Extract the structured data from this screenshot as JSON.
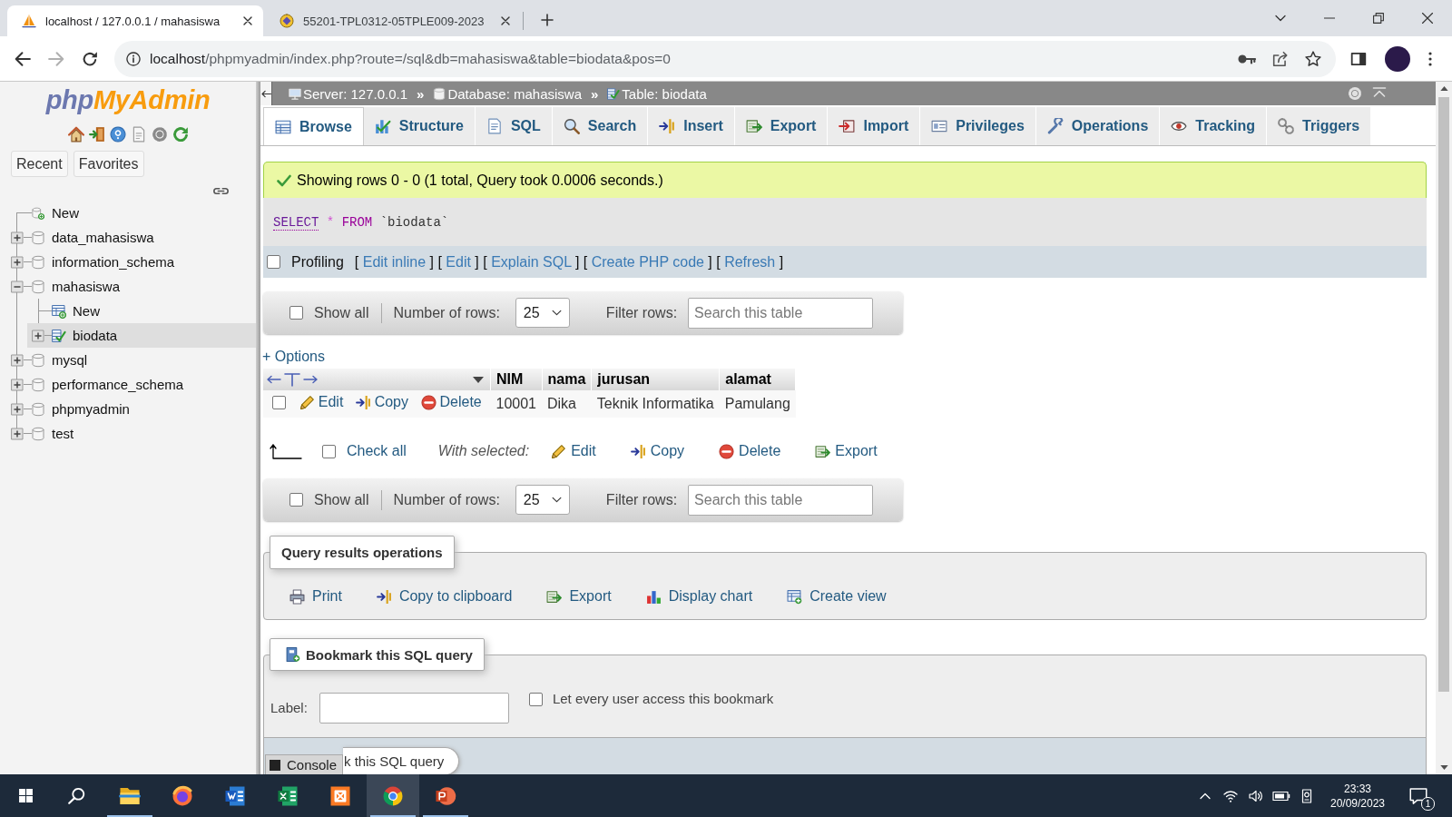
{
  "browser": {
    "tabs": [
      {
        "title": "localhost / 127.0.0.1 / mahasiswa",
        "selected": true
      },
      {
        "title": "55201-TPL0312-05TPLE009-2023",
        "selected": false
      }
    ],
    "can_go_forward": false,
    "url_host": "localhost",
    "url_path": "/phpmyadmin/index.php?route=/sql&db=mahasiswa&table=biodata&pos=0"
  },
  "sidebar": {
    "logo": {
      "prefix": "php",
      "name": "MyAdmin"
    },
    "buttons": [
      "Recent",
      "Favorites"
    ],
    "tree": [
      {
        "label": "New",
        "kind": "new_database",
        "selected": false
      },
      {
        "label": "data_mahasiswa",
        "kind": "database",
        "expanded": false,
        "selected": false
      },
      {
        "label": "information_schema",
        "kind": "database",
        "expanded": false,
        "selected": false
      },
      {
        "label": "mahasiswa",
        "kind": "database",
        "expanded": true,
        "selected": false,
        "children": [
          {
            "label": "New",
            "kind": "new_table",
            "selected": false
          },
          {
            "label": "biodata",
            "kind": "table",
            "expanded": false,
            "selected": true
          }
        ]
      },
      {
        "label": "mysql",
        "kind": "database",
        "expanded": false,
        "selected": false
      },
      {
        "label": "performance_schema",
        "kind": "database",
        "expanded": false,
        "selected": false
      },
      {
        "label": "phpmyadmin",
        "kind": "database",
        "expanded": false,
        "selected": false
      },
      {
        "label": "test",
        "kind": "database",
        "expanded": false,
        "selected": false
      }
    ]
  },
  "breadcrumb": [
    {
      "label": "Server: 127.0.0.1",
      "separator": "»"
    },
    {
      "label": "Database: mahasiswa",
      "separator": "»"
    },
    {
      "label": "Table: biodata"
    }
  ],
  "tabs": [
    {
      "label": "Browse",
      "selected": true
    },
    {
      "label": "Structure",
      "selected": false
    },
    {
      "label": "SQL",
      "selected": false
    },
    {
      "label": "Search",
      "selected": false
    },
    {
      "label": "Insert",
      "selected": false
    },
    {
      "label": "Export",
      "selected": false
    },
    {
      "label": "Import",
      "selected": false
    },
    {
      "label": "Privileges",
      "selected": false
    },
    {
      "label": "Operations",
      "selected": false
    },
    {
      "label": "Tracking",
      "selected": false
    },
    {
      "label": "Triggers",
      "selected": false
    }
  ],
  "message": {
    "kind": "success",
    "text": "Showing rows 0 - 0 (1 total, Query took 0.0006 seconds.)"
  },
  "sql": [
    {
      "text": "SELECT",
      "kind": "keyword",
      "link": true
    },
    {
      "text": "*",
      "kind": "operator",
      "link": false
    },
    {
      "text": "FROM",
      "kind": "keyword",
      "link": false
    },
    {
      "text": "`biodata`",
      "kind": "identifier",
      "link": false
    }
  ],
  "profiling": {
    "label": "Profiling",
    "checked": false,
    "links": [
      {
        "open": "[",
        "label": "Edit inline",
        "close": "]"
      },
      {
        "open": "[",
        "label": "Edit",
        "close": "]"
      },
      {
        "open": "[",
        "label": "Explain SQL",
        "close": "]"
      },
      {
        "open": "[",
        "label": "Create PHP code",
        "close": "]"
      },
      {
        "open": "[",
        "label": "Refresh",
        "close": "]"
      }
    ]
  },
  "navigation_bars": [
    {
      "show_all": {
        "label": "Show all",
        "checked": false
      },
      "rows_label": "Number of rows:",
      "rows_value": "25",
      "filter_label": "Filter rows:",
      "filter_placeholder": "Search this table"
    },
    {
      "show_all": {
        "label": "Show all",
        "checked": false
      },
      "rows_label": "Number of rows:",
      "rows_value": "25",
      "filter_label": "Filter rows:",
      "filter_placeholder": "Search this table"
    }
  ],
  "options_link": "+ Options",
  "table": {
    "columns": [
      "NIM",
      "nama",
      "jurusan",
      "alamat"
    ],
    "rows": [
      {
        "checked": false,
        "actions": [
          "Edit",
          "Copy",
          "Delete"
        ],
        "cells": [
          "10001",
          "Dika",
          "Teknik Informatika",
          "Pamulang"
        ]
      }
    ]
  },
  "bulk_actions": {
    "check_all": {
      "label": "Check all",
      "checked": false
    },
    "with_selected": "With selected:",
    "actions": [
      "Edit",
      "Copy",
      "Delete",
      "Export"
    ]
  },
  "query_operations": {
    "title": "Query results operations",
    "links": [
      "Print",
      "Copy to clipboard",
      "Export",
      "Display chart",
      "Create view"
    ]
  },
  "bookmark": {
    "title": "Bookmark this SQL query",
    "label": "Label:",
    "public": {
      "label": "Let every user access this bookmark",
      "checked": false
    },
    "submit": "k this SQL query"
  },
  "console": {
    "label": "Console"
  },
  "taskbar": {
    "apps": [
      {
        "running": true,
        "selected": false
      },
      {
        "running": false,
        "selected": false
      },
      {
        "running": false,
        "selected": false
      },
      {
        "running": false,
        "selected": false
      },
      {
        "running": false,
        "selected": false
      },
      {
        "running": true,
        "selected": true
      },
      {
        "running": true,
        "selected": false
      }
    ],
    "time": "23:33",
    "date": "20/09/2023",
    "notification_count": "1"
  }
}
